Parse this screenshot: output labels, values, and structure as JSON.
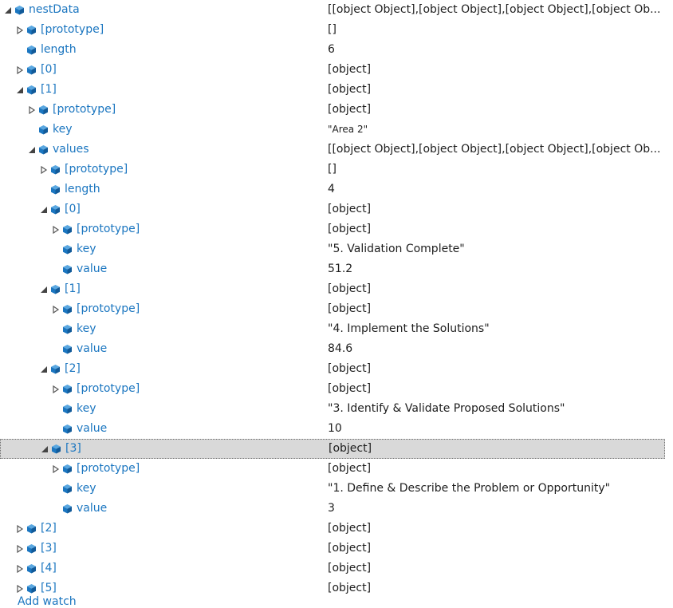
{
  "colors": {
    "name_text": "#1b76c0",
    "value_text": "#1e1e1e",
    "icon_fill": "#1b76c0",
    "selected_bg": "#d9d9d9"
  },
  "rows": [
    {
      "depth": 0,
      "state": "expanded",
      "name": "nestData",
      "value": "[[object Object],[object Object],[object Object],[object Ob..."
    },
    {
      "depth": 1,
      "state": "collapsed",
      "name": "[prototype]",
      "value": "[]"
    },
    {
      "depth": 1,
      "state": "leaf",
      "name": "length",
      "value": "6"
    },
    {
      "depth": 1,
      "state": "collapsed",
      "name": "[0]",
      "value": "[object]"
    },
    {
      "depth": 1,
      "state": "expanded",
      "name": "[1]",
      "value": "[object]"
    },
    {
      "depth": 2,
      "state": "collapsed",
      "name": "[prototype]",
      "value": "[object]"
    },
    {
      "depth": 2,
      "state": "leaf",
      "name": "key",
      "value": "\"Area 2\"",
      "small": true
    },
    {
      "depth": 2,
      "state": "expanded",
      "name": "values",
      "value": "[[object Object],[object Object],[object Object],[object Ob..."
    },
    {
      "depth": 3,
      "state": "collapsed",
      "name": "[prototype]",
      "value": "[]"
    },
    {
      "depth": 3,
      "state": "leaf",
      "name": "length",
      "value": "4"
    },
    {
      "depth": 3,
      "state": "expanded",
      "name": "[0]",
      "value": "[object]"
    },
    {
      "depth": 4,
      "state": "collapsed",
      "name": "[prototype]",
      "value": "[object]"
    },
    {
      "depth": 4,
      "state": "leaf",
      "name": "key",
      "value": "\"5. Validation Complete\""
    },
    {
      "depth": 4,
      "state": "leaf",
      "name": "value",
      "value": "51.2"
    },
    {
      "depth": 3,
      "state": "expanded",
      "name": "[1]",
      "value": "[object]"
    },
    {
      "depth": 4,
      "state": "collapsed",
      "name": "[prototype]",
      "value": "[object]"
    },
    {
      "depth": 4,
      "state": "leaf",
      "name": "key",
      "value": "\"4. Implement the Solutions\""
    },
    {
      "depth": 4,
      "state": "leaf",
      "name": "value",
      "value": "84.6"
    },
    {
      "depth": 3,
      "state": "expanded",
      "name": "[2]",
      "value": "[object]"
    },
    {
      "depth": 4,
      "state": "collapsed",
      "name": "[prototype]",
      "value": "[object]"
    },
    {
      "depth": 4,
      "state": "leaf",
      "name": "key",
      "value": "\"3. Identify & Validate Proposed Solutions\""
    },
    {
      "depth": 4,
      "state": "leaf",
      "name": "value",
      "value": "10"
    },
    {
      "depth": 3,
      "state": "expanded",
      "name": "[3]",
      "value": "[object]",
      "selected": true
    },
    {
      "depth": 4,
      "state": "collapsed",
      "name": "[prototype]",
      "value": "[object]"
    },
    {
      "depth": 4,
      "state": "leaf",
      "name": "key",
      "value": "\"1. Define & Describe the Problem or Opportunity\""
    },
    {
      "depth": 4,
      "state": "leaf",
      "name": "value",
      "value": "3"
    },
    {
      "depth": 1,
      "state": "collapsed",
      "name": "[2]",
      "value": "[object]"
    },
    {
      "depth": 1,
      "state": "collapsed",
      "name": "[3]",
      "value": "[object]"
    },
    {
      "depth": 1,
      "state": "collapsed",
      "name": "[4]",
      "value": "[object]"
    },
    {
      "depth": 1,
      "state": "collapsed",
      "name": "[5]",
      "value": "[object]"
    }
  ],
  "footer": {
    "partial_text": "Add watch"
  }
}
